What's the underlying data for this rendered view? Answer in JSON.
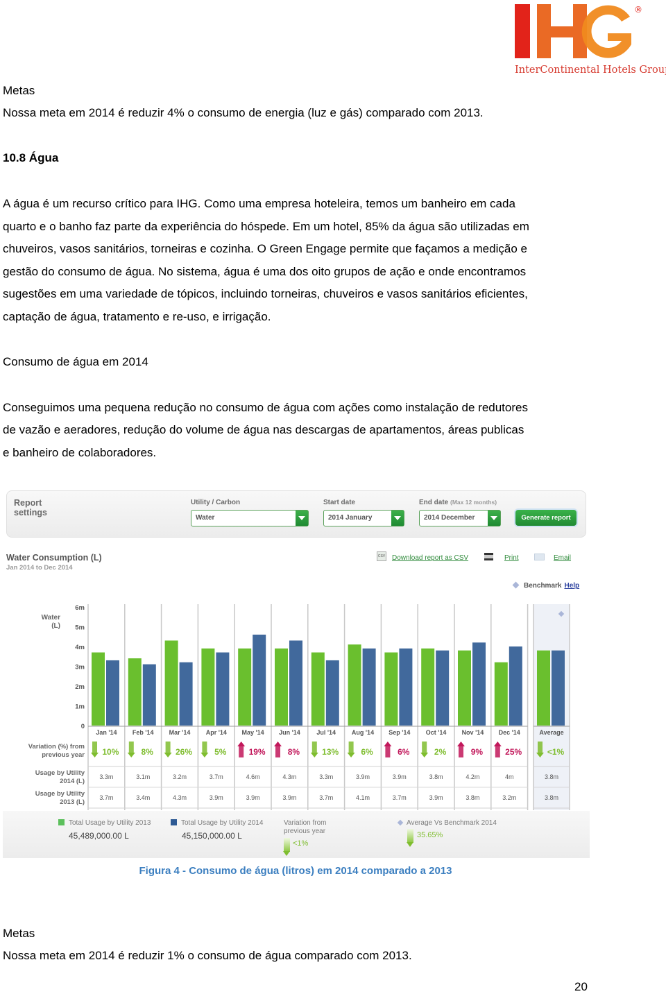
{
  "logo": {
    "text": "IHG",
    "registered": "®",
    "tagline": "InterContinental Hotels Group",
    "colors": {
      "I": "#e2231a",
      "H": "#ea6a25",
      "G": "#f08a1d",
      "tagline": "#d63a2f"
    }
  },
  "section_energy": {
    "heading": "Metas",
    "goal": "Nossa meta em 2014 é reduzir 4% o consumo de energia (luz e gás) comparado com 2013."
  },
  "section_water": {
    "title": "10.8 Água",
    "paragraph_lines": [
      "A água é um recurso crítico para IHG. Como uma empresa hoteleira, temos um banheiro em cada",
      "quarto e o banho faz parte da experiência do hóspede. Em um hotel, 85% da água são utilizadas em",
      "chuveiros, vasos sanitários, torneiras e cozinha. O Green Engage permite que façamos a medição e",
      "gestão do consumo de água. No sistema, água é uma dos oito grupos de ação e onde encontramos",
      "sugestões em uma variedade de tópicos, incluindo torneiras, chuveiros e vasos sanitários eficientes,",
      "captação de água, tratamento e re-uso, e irrigação."
    ],
    "subheading": "Consumo de água em 2014",
    "paragraph2_lines": [
      "Conseguimos uma pequena redução no consumo de água com ações como instalação de redutores",
      "de vazão e aeradores, redução do volume de água nas descargas de apartamentos, áreas publicas",
      "e banheiro de colaboradores."
    ]
  },
  "report": {
    "settings_title_1": "Report",
    "settings_title_2": "settings",
    "utility_label": "Utility / Carbon",
    "utility_value": "Water",
    "start_label": "Start date",
    "start_value": "2014 January",
    "end_label": "End date",
    "end_note": "(Max 12 months)",
    "end_value": "2014 December",
    "generate_label": "Generate report",
    "title": "Water Consumption (L)",
    "subtitle": "Jan 2014 to Dec 2014",
    "download_label": "Download report as CSV",
    "print_label": "Print",
    "email_label": "Email",
    "benchmark_label": "Benchmark",
    "help_label": "Help",
    "colors": {
      "series_2013": "#6abf2e",
      "series_2014": "#41699c",
      "increase": "#c2185b",
      "decrease": "#7fbd2f",
      "button_green": "#2e9e3e"
    }
  },
  "chart_data": {
    "type": "bar",
    "title": "Water Consumption (L)",
    "subtitle": "Jan 2014 to Dec 2014",
    "ylabel": "Water (L)",
    "ylim": [
      0,
      6000000
    ],
    "yticks": [
      "0",
      "1m",
      "2m",
      "3m",
      "4m",
      "5m",
      "6m"
    ],
    "categories": [
      "Jan '14",
      "Feb '14",
      "Mar '14",
      "Apr '14",
      "May '14",
      "Jun '14",
      "Jul '14",
      "Aug '14",
      "Sep '14",
      "Oct '14",
      "Nov '14",
      "Dec '14",
      "Average"
    ],
    "series": [
      {
        "name": "Total Usage by Utility 2013",
        "values": [
          3700000,
          3400000,
          4300000,
          3900000,
          3900000,
          3900000,
          3700000,
          4100000,
          3700000,
          3900000,
          3800000,
          3200000,
          3800000
        ]
      },
      {
        "name": "Total Usage by Utility 2014",
        "values": [
          3300000,
          3100000,
          3200000,
          3700000,
          4600000,
          4300000,
          3300000,
          3900000,
          3900000,
          3800000,
          4200000,
          4000000,
          3800000
        ]
      }
    ],
    "variation": [
      {
        "dir": "down",
        "text": "10%"
      },
      {
        "dir": "down",
        "text": "8%"
      },
      {
        "dir": "down",
        "text": "26%"
      },
      {
        "dir": "down",
        "text": "5%"
      },
      {
        "dir": "up",
        "text": "19%"
      },
      {
        "dir": "up",
        "text": "8%"
      },
      {
        "dir": "down",
        "text": "13%"
      },
      {
        "dir": "down",
        "text": "6%"
      },
      {
        "dir": "up",
        "text": "6%"
      },
      {
        "dir": "down",
        "text": "2%"
      },
      {
        "dir": "up",
        "text": "9%"
      },
      {
        "dir": "up",
        "text": "25%"
      },
      {
        "dir": "down",
        "text": "<1%"
      }
    ],
    "row_labels": {
      "variation_1": "Variation (%) from",
      "variation_2": "previous year",
      "usage2014_1": "Usage by Utility",
      "usage2014_2": "2014 (L)",
      "usage2013_1": "Usage by Utility",
      "usage2013_2": "2013 (L)"
    },
    "usage_2014": [
      "3.3m",
      "3.1m",
      "3.2m",
      "3.7m",
      "4.6m",
      "4.3m",
      "3.3m",
      "3.9m",
      "3.9m",
      "3.8m",
      "4.2m",
      "4m",
      "3.8m"
    ],
    "usage_2013": [
      "3.7m",
      "3.4m",
      "4.3m",
      "3.9m",
      "3.9m",
      "3.9m",
      "3.7m",
      "4.1m",
      "3.7m",
      "3.9m",
      "3.8m",
      "3.2m",
      "3.8m"
    ],
    "legend": [
      {
        "label": "Total Usage by Utility 2013",
        "value": "45,489,000.00  L"
      },
      {
        "label": "Total Usage by Utility 2014",
        "value": "45,150,000.00  L"
      }
    ],
    "variation_summary": {
      "label_1": "Variation from",
      "label_2": "previous year",
      "value": "<1%"
    },
    "benchmark_summary": {
      "label": "Average Vs Benchmark 2014",
      "value": "35.65%"
    },
    "grid": true,
    "legend_position": "bottom"
  },
  "caption": "Figura 4 - Consumo de água (litros) em 2014 comparado a 2013",
  "section_water_goal": {
    "heading": "Metas",
    "goal": "Nossa meta em 2014 é reduzir 1% o consumo de água comparado com 2013."
  },
  "page_number": "20"
}
